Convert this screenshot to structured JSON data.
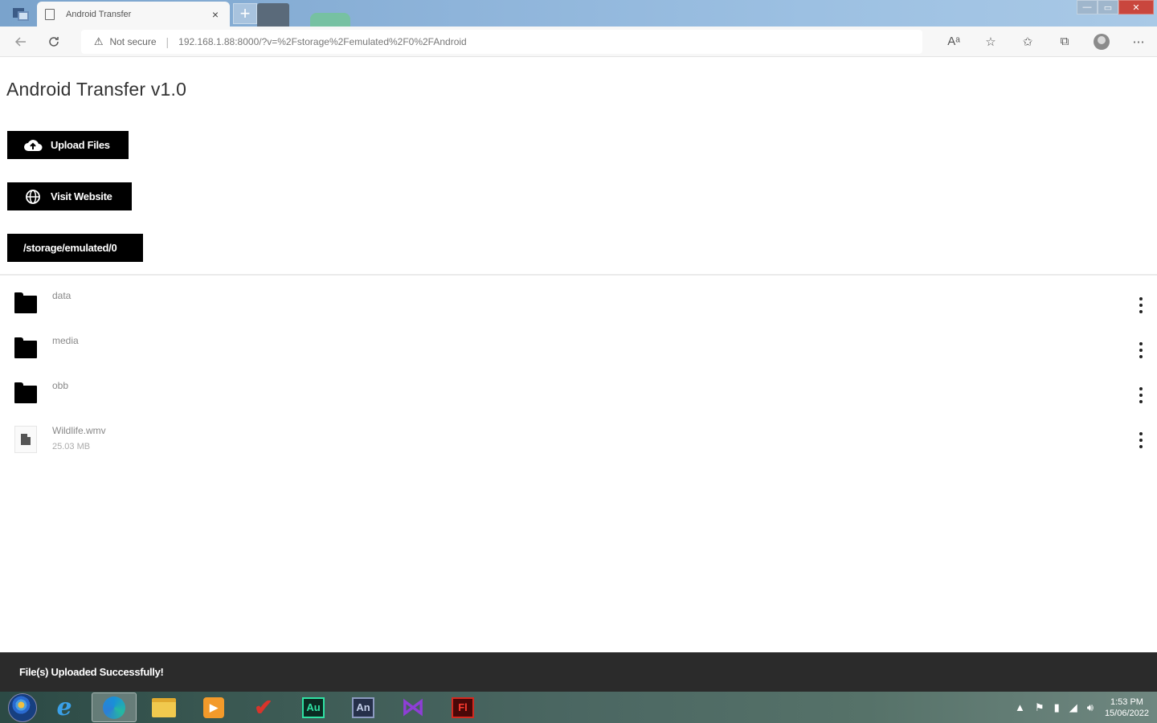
{
  "browser": {
    "tab_title": "Android Transfer",
    "tab_close": "×",
    "new_tab": "+",
    "security_label": "Not secure",
    "url": "192.168.1.88:8000/?v=%2Fstorage%2Femulated%2F0%2FAndroid",
    "window_controls": {
      "minimize": "—",
      "maximize": "▭",
      "close": "✕"
    }
  },
  "page": {
    "title": "Android Transfer v1.0",
    "buttons": {
      "upload_label": "Upload Files",
      "visit_label": "Visit Website",
      "path_label": "/storage/emulated/0"
    },
    "files": [
      {
        "name": "data",
        "type": "folder",
        "size": ""
      },
      {
        "name": "media",
        "type": "folder",
        "size": ""
      },
      {
        "name": "obb",
        "type": "folder",
        "size": ""
      },
      {
        "name": "Wildlife.wmv",
        "type": "file",
        "size": "25.03 MB"
      }
    ]
  },
  "snackbar": {
    "message": "File(s) Uploaded Successfully!"
  },
  "taskbar": {
    "apps": [
      "start-orb-icon",
      "internet-explorer-icon",
      "edge-icon",
      "file-explorer-icon",
      "media-player-icon",
      "checkmark-app-icon",
      "audition-icon",
      "animate-icon",
      "visual-studio-icon",
      "flash-icon"
    ],
    "app_labels": {
      "audition": "Au",
      "animate": "An",
      "flash": "Fl"
    },
    "clock_time": "1:53 PM",
    "clock_date": "15/06/2022"
  },
  "colors": {
    "button_bg": "#000000",
    "snackbar_bg": "#2b2b2b",
    "title_text": "#333333"
  }
}
